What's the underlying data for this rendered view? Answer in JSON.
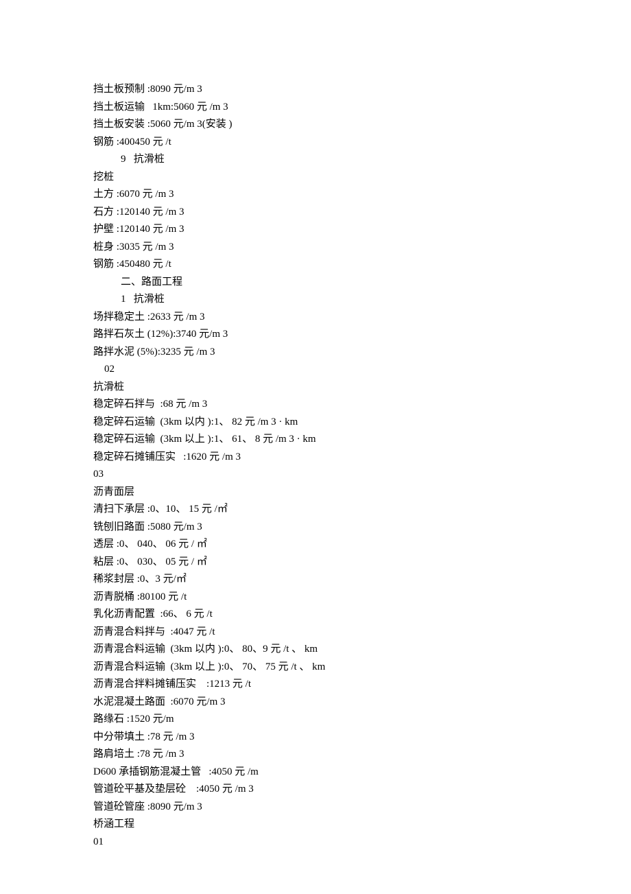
{
  "lines": [
    {
      "t": "挡土板预制 :8090 元/m 3",
      "cls": ""
    },
    {
      "t": "挡土板运输   1km:5060 元 /m 3",
      "cls": ""
    },
    {
      "t": "挡土板安装 :5060 元/m 3(安装 )",
      "cls": ""
    },
    {
      "t": "钢筋 :400450 元 /t",
      "cls": ""
    },
    {
      "t": "9   抗滑桩",
      "cls": "indent1"
    },
    {
      "t": "挖桩",
      "cls": ""
    },
    {
      "t": "土方 :6070 元 /m 3",
      "cls": ""
    },
    {
      "t": "石方 :120140 元 /m 3",
      "cls": ""
    },
    {
      "t": "护壁 :120140 元 /m 3",
      "cls": ""
    },
    {
      "t": "桩身 :3035 元 /m 3",
      "cls": ""
    },
    {
      "t": "钢筋 :450480 元 /t",
      "cls": ""
    },
    {
      "t": "二、路面工程",
      "cls": "indent1"
    },
    {
      "t": "1   抗滑桩",
      "cls": "indent1"
    },
    {
      "t": "场拌稳定土 :2633 元 /m 3",
      "cls": ""
    },
    {
      "t": "路拌石灰土 (12%):3740 元/m 3",
      "cls": ""
    },
    {
      "t": "路拌水泥 (5%):3235 元 /m 3",
      "cls": ""
    },
    {
      "t": "02",
      "cls": "indent2"
    },
    {
      "t": "抗滑桩",
      "cls": ""
    },
    {
      "t": "稳定碎石拌与  :68 元 /m 3",
      "cls": ""
    },
    {
      "t": "稳定碎石运输  (3km 以内 ):1、 82 元 /m 3 · km",
      "cls": ""
    },
    {
      "t": "稳定碎石运输  (3km 以上 ):1、 61、 8 元 /m 3 · km",
      "cls": ""
    },
    {
      "t": "稳定碎石摊铺压实   :1620 元 /m 3",
      "cls": ""
    },
    {
      "t": "03",
      "cls": ""
    },
    {
      "t": "沥青面层",
      "cls": ""
    },
    {
      "t": "清扫下承层 :0、10、 15 元 /㎡",
      "cls": ""
    },
    {
      "t": "铣刨旧路面 :5080 元/m 3",
      "cls": ""
    },
    {
      "t": "透层 :0、 040、 06 元 / ㎡",
      "cls": ""
    },
    {
      "t": "粘层 :0、 030、 05 元 / ㎡",
      "cls": ""
    },
    {
      "t": "稀浆封层 :0、3 元/㎡",
      "cls": ""
    },
    {
      "t": "沥青脱桶 :80100 元 /t",
      "cls": ""
    },
    {
      "t": "乳化沥青配置  :66、 6 元 /t",
      "cls": ""
    },
    {
      "t": "沥青混合料拌与  :4047 元 /t",
      "cls": ""
    },
    {
      "t": "沥青混合料运输  (3km 以内 ):0、 80、9 元 /t 、 km",
      "cls": ""
    },
    {
      "t": "沥青混合料运输  (3km 以上 ):0、 70、 75 元 /t 、 km",
      "cls": ""
    },
    {
      "t": "沥青混合拌料摊铺压实    :1213 元 /t",
      "cls": ""
    },
    {
      "t": "水泥混凝土路面  :6070 元/m 3",
      "cls": ""
    },
    {
      "t": "路缘石 :1520 元/m",
      "cls": ""
    },
    {
      "t": "中分带填土 :78 元 /m 3",
      "cls": ""
    },
    {
      "t": "路肩培土 :78 元 /m 3",
      "cls": ""
    },
    {
      "t": "D600 承插钢筋混凝土管   :4050 元 /m",
      "cls": ""
    },
    {
      "t": "管道砼平基及垫层砼    :4050 元 /m 3",
      "cls": ""
    },
    {
      "t": "管道砼管座 :8090 元/m 3",
      "cls": ""
    },
    {
      "t": "桥涵工程",
      "cls": ""
    },
    {
      "t": "01",
      "cls": ""
    }
  ]
}
